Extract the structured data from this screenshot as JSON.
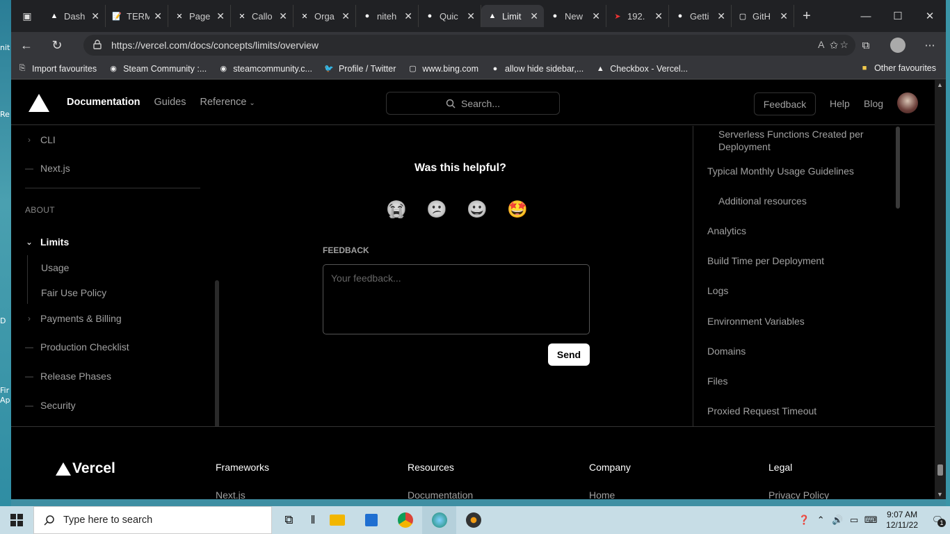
{
  "desktop": {
    "side_labels": [
      "nit",
      "Re",
      "D",
      "Fir",
      "Ap"
    ]
  },
  "tabs": [
    {
      "title": "Dash",
      "fav": "▲"
    },
    {
      "title": "TERM",
      "fav": "📝"
    },
    {
      "title": "Page",
      "fav": "✕"
    },
    {
      "title": "Callo",
      "fav": "✕"
    },
    {
      "title": "Orga",
      "fav": "✕"
    },
    {
      "title": "niteh",
      "fav": "●"
    },
    {
      "title": "Quic",
      "fav": "●"
    },
    {
      "title": "Limit",
      "fav": "▲"
    },
    {
      "title": "New",
      "fav": "●"
    },
    {
      "title": "192.",
      "fav": "➤"
    },
    {
      "title": "Getti",
      "fav": "●"
    },
    {
      "title": "GitH",
      "fav": "▢"
    }
  ],
  "address": {
    "url": "https://vercel.com/docs/concepts/limits/overview"
  },
  "bookmarks": [
    {
      "label": "Import favourites",
      "icon": "⎘"
    },
    {
      "label": "Steam Community :...",
      "icon": "◉"
    },
    {
      "label": "steamcommunity.c...",
      "icon": "◉"
    },
    {
      "label": "Profile / Twitter",
      "icon": "🐦"
    },
    {
      "label": "www.bing.com",
      "icon": "▢"
    },
    {
      "label": "allow hide sidebar,...",
      "icon": "●"
    },
    {
      "label": "Checkbox - Vercel...",
      "icon": "▲"
    }
  ],
  "bookmarks_right": {
    "label": "Other favourites"
  },
  "header": {
    "nav": {
      "documentation": "Documentation",
      "guides": "Guides",
      "reference": "Reference"
    },
    "search_placeholder": "Search...",
    "feedback": "Feedback",
    "help": "Help",
    "blog": "Blog"
  },
  "sidebar": {
    "cli": "CLI",
    "nextjs": "Next.js",
    "about": "ABOUT",
    "limits": "Limits",
    "usage": "Usage",
    "fair_use": "Fair Use Policy",
    "payments": "Payments & Billing",
    "production": "Production Checklist",
    "release": "Release Phases",
    "security": "Security"
  },
  "main": {
    "helpful": "Was this helpful?",
    "feedback_label": "FEEDBACK",
    "feedback_placeholder": "Your feedback...",
    "send": "Send",
    "emojis": [
      "😭",
      "😕",
      "😀",
      "🤩"
    ]
  },
  "toc": {
    "serverless": "Serverless Functions Created per",
    "serverless2": "Deployment",
    "typical": "Typical Monthly Usage Guidelines",
    "additional": "Additional resources",
    "analytics": "Analytics",
    "build": "Build Time per Deployment",
    "logs": "Logs",
    "env": "Environment Variables",
    "domains": "Domains",
    "files": "Files",
    "proxied": "Proxied Request Timeout"
  },
  "footer": {
    "brand": "Vercel",
    "frameworks": {
      "h": "Frameworks",
      "l": "Next.js"
    },
    "resources": {
      "h": "Resources",
      "l": "Documentation"
    },
    "company": {
      "h": "Company",
      "l": "Home"
    },
    "legal": {
      "h": "Legal",
      "l": "Privacy Policy"
    }
  },
  "taskbar": {
    "search": "Type here to search",
    "time": "9:07 AM",
    "date": "12/11/22",
    "notif": "1"
  }
}
